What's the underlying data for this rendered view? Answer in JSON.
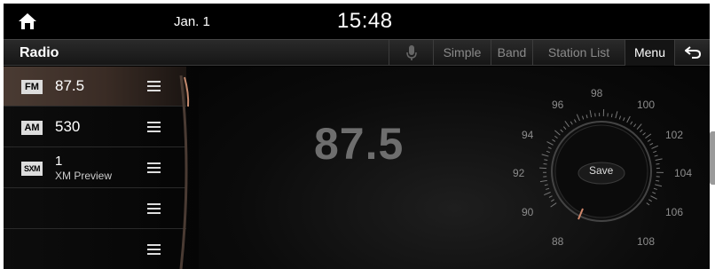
{
  "status_bar": {
    "date": "Jan. 1",
    "time": "15:48"
  },
  "title_bar": {
    "title": "Radio",
    "tabs": [
      {
        "label": "Simple"
      },
      {
        "label": "Band"
      },
      {
        "label": "Station List"
      },
      {
        "label": "Menu"
      }
    ]
  },
  "presets": [
    {
      "band": "FM",
      "freq": "87.5",
      "sub": "",
      "active": true
    },
    {
      "band": "AM",
      "freq": "530",
      "sub": "",
      "active": false
    },
    {
      "band": "SXM",
      "freq": "1",
      "sub": "XM Preview",
      "active": false
    },
    {
      "band": "",
      "freq": "",
      "sub": "",
      "active": false
    },
    {
      "band": "",
      "freq": "",
      "sub": "",
      "active": false
    }
  ],
  "main": {
    "frequency": "87.5",
    "save_label": "Save"
  },
  "dial": {
    "labels": [
      "98",
      "100",
      "102",
      "104",
      "106",
      "108",
      "88",
      "90",
      "92",
      "94",
      "96"
    ]
  },
  "colors": {
    "active_preset": "#4a3b33",
    "accent": "#d0876b",
    "dim_text": "#6e6e6e"
  },
  "icons": {
    "home": "home-icon",
    "mic": "microphone-icon",
    "back": "back-arrow-icon",
    "preset_handle": "list-icon"
  }
}
